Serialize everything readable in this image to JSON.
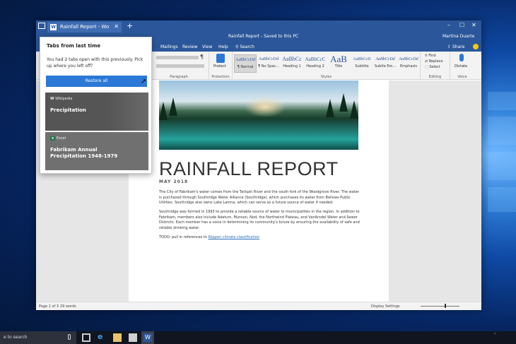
{
  "tabs": {
    "active_label": "Rainfall Report - Wo",
    "new_tab": "+"
  },
  "window": {
    "title": "Rainfall Report - Saved to this PC",
    "user": "Martina Duarte",
    "minimize": "–",
    "maximize": "☐",
    "close": "✕"
  },
  "ribbon": {
    "tabs": [
      "Mailings",
      "Review",
      "View",
      "Help"
    ],
    "search": "Search",
    "share": "Share",
    "styles": [
      {
        "sample": "AaBbCcDd",
        "name": "¶ Normal"
      },
      {
        "sample": "AaBbCcDd",
        "name": "¶ No Spac..."
      },
      {
        "sample": "AaBbCc",
        "name": "Heading 1"
      },
      {
        "sample": "AaBbCcC",
        "name": "Heading 2"
      },
      {
        "sample": "AaB",
        "name": "Title"
      },
      {
        "sample": "AaBbCcD",
        "name": "Subtitle"
      },
      {
        "sample": "AaBbCcDd",
        "name": "Subtle Em..."
      },
      {
        "sample": "AaBbCcDd",
        "name": "Emphasis"
      }
    ],
    "find": "Find",
    "replace": "Replace",
    "select": "Select",
    "dictate": "Dictate",
    "protect": "Protect",
    "group_labels": {
      "paragraph": "Paragraph",
      "protection": "Protection",
      "styles": "Styles",
      "editing": "Editing",
      "voice": "Voice"
    }
  },
  "document": {
    "heading": "RAINFALL REPORT",
    "date": "MAY 2018",
    "paragraphs": [
      "The City of Fabrikam's water comes from the Tailspin River and the south fork of the Woodgrove River. The water is purchased through Southridge Water Alliance (Southridge), which purchases its water from Bellows Public Utilities. Southridge also owns Lake Lamna, which can serve as a future source of water if needed.",
      "Southridge was formed in 1993 to provide a reliable source of water to municipalities in the region. In addition to Fabrikam, members also include Adatum, Munson, Nod, the Northwind Plateau, and VanArsdel Water and Sewer Districts. Each member has a voice in determining its community's future by ensuring the availability of safe and reliable drinking water."
    ],
    "todo_prefix": "TODO: pull in references to ",
    "todo_link": "Köppen climate classification"
  },
  "status": {
    "page": "Page 1 of 3",
    "words": "29 words",
    "display": "Display Settings"
  },
  "flyout": {
    "title": "Tabs from last time",
    "message": "You had 2 tabs open with this previously. Pick up where you left off?",
    "restore": "Restore all",
    "cards": [
      {
        "source": "Wikipedia",
        "title": "Precipitation"
      },
      {
        "source": "Excel",
        "title": "Fabrikam Annual Precipitation 1948-1979"
      }
    ]
  },
  "taskbar": {
    "search_placeholder": "e to search"
  }
}
